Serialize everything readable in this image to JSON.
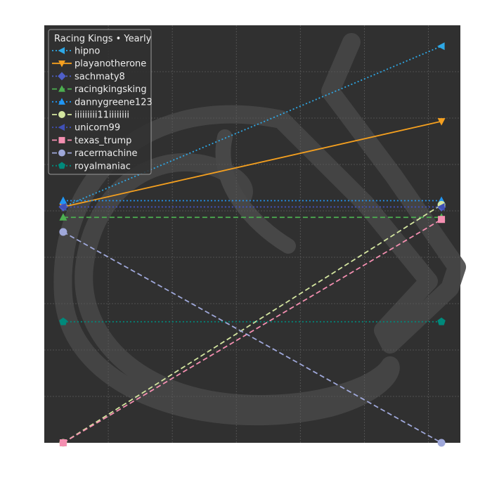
{
  "chart_data": {
    "type": "line",
    "legend_title": "Racing Kings • Yearly",
    "legend_position": "top-left",
    "grid": true,
    "background": "#303030",
    "x": [
      0,
      1
    ],
    "xlim": [
      -0.05,
      1.05
    ],
    "ylim": [
      0,
      100
    ],
    "series": [
      {
        "name": "hipno",
        "color": "#2ea8e6",
        "dash": "dotted",
        "marker": "triangle-left",
        "values": [
          56.5,
          95
        ]
      },
      {
        "name": "playanotherone",
        "color": "#f5a01f",
        "dash": "solid",
        "marker": "triangle-down",
        "values": [
          56.5,
          77
        ]
      },
      {
        "name": "sachmaty8",
        "color": "#4f5fc8",
        "dash": "dotted",
        "marker": "diamond",
        "values": [
          56.5,
          56.5
        ]
      },
      {
        "name": "racingkingsking",
        "color": "#4caf50",
        "dash": "dashed",
        "marker": "triangle-up",
        "values": [
          54,
          54
        ]
      },
      {
        "name": "dannygreene123",
        "color": "#2196f3",
        "dash": "dotted",
        "marker": "triangle-up",
        "values": [
          58,
          58
        ]
      },
      {
        "name": "iiiiiiiii11iiiiiiii",
        "color": "#d4e6a0",
        "dash": "dashed",
        "marker": "circle",
        "values": [
          0,
          57
        ]
      },
      {
        "name": "unicorn99",
        "color": "#4050b5",
        "dash": "dotted",
        "marker": "triangle-left",
        "values": [
          56.5,
          56.5
        ]
      },
      {
        "name": "texas_trump",
        "color": "#f48fb1",
        "dash": "dashed",
        "marker": "square",
        "values": [
          0,
          53.5
        ]
      },
      {
        "name": "racermachine",
        "color": "#9fa8da",
        "dash": "dashed",
        "marker": "circle",
        "values": [
          50.5,
          0
        ]
      },
      {
        "name": "royalmaniac",
        "color": "#00897b",
        "dash": "dotted",
        "marker": "pentagon",
        "values": [
          29,
          29
        ]
      }
    ]
  }
}
